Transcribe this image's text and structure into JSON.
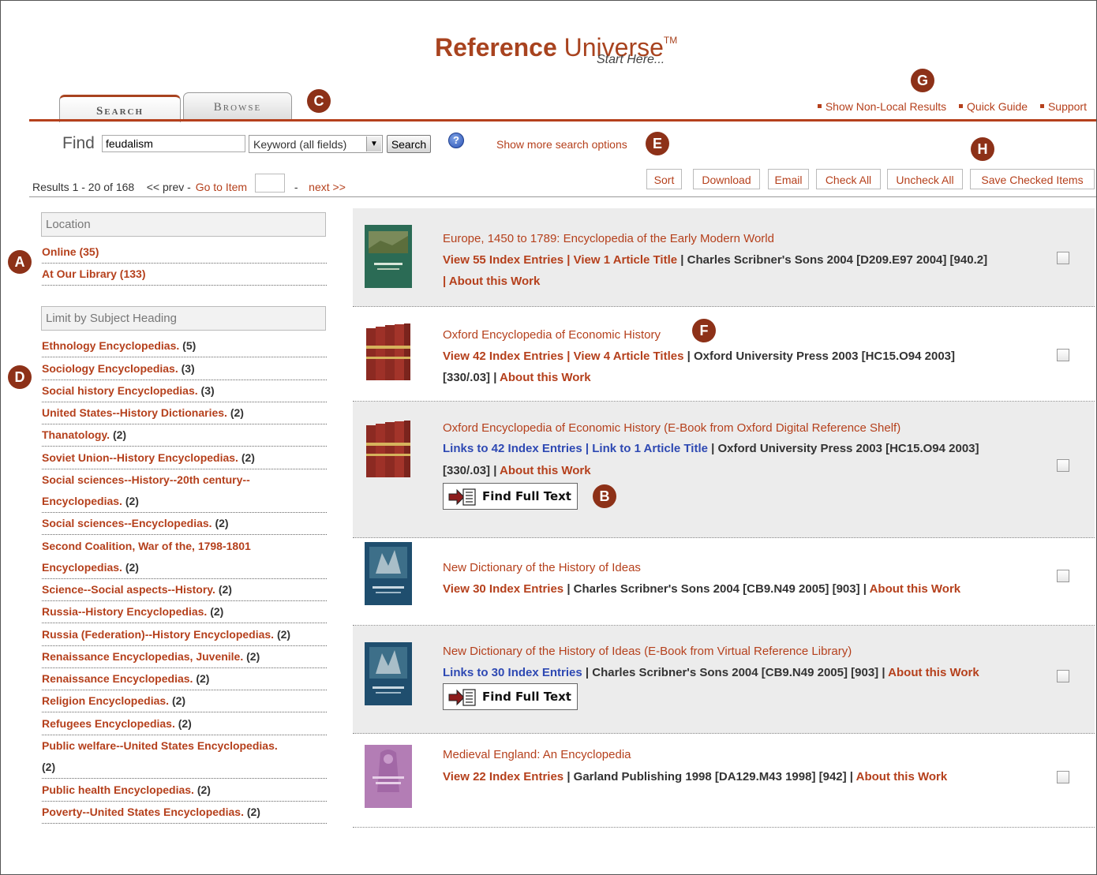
{
  "header": {
    "logo_ref": "Reference",
    "logo_universe": "Universe",
    "logo_tm": "TM",
    "tagline": "Start Here..."
  },
  "tabs": [
    {
      "label": "Search",
      "active": true
    },
    {
      "label": "Browse",
      "active": false
    }
  ],
  "top_links": [
    "Show Non-Local Results",
    "Quick Guide",
    "Support"
  ],
  "search": {
    "find_label": "Find",
    "query": "feudalism",
    "field_select": "Keyword (all fields)",
    "button": "Search",
    "help_icon": "?",
    "more_options": "Show more search options"
  },
  "results_bar": {
    "range": "Results 1 - 20 of 168",
    "prev": "<< prev",
    "dash1": "-",
    "goto": "Go to Item",
    "dash2": "-",
    "next": "next >>",
    "actions": [
      "Sort",
      "Download",
      "Email",
      "Check All",
      "Uncheck All",
      "Save Checked Items"
    ]
  },
  "sidebar": {
    "location_heading": "Location",
    "location_items": [
      {
        "label": "Online",
        "count": "(35)"
      },
      {
        "label": "At Our Library",
        "count": "(133)"
      }
    ],
    "subject_heading": "Limit by Subject Heading",
    "subject_items": [
      {
        "label": "Ethnology Encyclopedias.",
        "count": "(5)"
      },
      {
        "label": "Sociology Encyclopedias.",
        "count": "(3)"
      },
      {
        "label": "Social history Encyclopedias.",
        "count": "(3)"
      },
      {
        "label": "United States--History Dictionaries.",
        "count": "(2)"
      },
      {
        "label": "Thanatology.",
        "count": "(2)"
      },
      {
        "label": "Soviet Union--History Encyclopedias.",
        "count": "(2)"
      },
      {
        "label": "Social sciences--History--20th century--",
        "label2": "Encyclopedias.",
        "count": "(2)"
      },
      {
        "label": "Social sciences--Encyclopedias.",
        "count": "(2)"
      },
      {
        "label": "Second Coalition, War of the, 1798-1801",
        "label2": "Encyclopedias.",
        "count": "(2)"
      },
      {
        "label": "Science--Social aspects--History.",
        "count": "(2)"
      },
      {
        "label": "Russia--History Encyclopedias.",
        "count": "(2)"
      },
      {
        "label": "Russia (Federation)--History Encyclopedias.",
        "count": "(2)"
      },
      {
        "label": "Renaissance Encyclopedias, Juvenile.",
        "count": "(2)"
      },
      {
        "label": "Renaissance Encyclopedias.",
        "count": "(2)"
      },
      {
        "label": "Religion Encyclopedias.",
        "count": "(2)"
      },
      {
        "label": "Refugees Encyclopedias.",
        "count": "(2)"
      },
      {
        "label": "Public welfare--United States Encyclopedias.",
        "label2": "",
        "count": "(2)"
      },
      {
        "label": "Public health Encyclopedias.",
        "count": "(2)"
      },
      {
        "label": "Poverty--United States Encyclopedias.",
        "count": "(2)"
      }
    ]
  },
  "results": [
    {
      "title": "Europe, 1450 to 1789: Encyclopedia of the Early Modern World",
      "links": "View 55 Index Entries | View 1 Article Title",
      "pub": "| Charles Scribner's Sons 2004 [D209.E97 2004] [940.2]",
      "about": "| About this Work"
    },
    {
      "title": "Oxford Encyclopedia of Economic History",
      "links": "View 42 Index Entries | View 4 Article Titles",
      "pub": "| Oxford University Press 2003 [HC15.O94 2003]",
      "pub2": "[330/.03] |",
      "about": "About this Work"
    },
    {
      "title": "Oxford Encyclopedia of Economic History (E-Book from Oxford Digital Reference Shelf)",
      "links": "Links to 42 Index Entries | Link to 1 Article Title",
      "pub": "| Oxford University Press 2003 [HC15.O94 2003]",
      "pub2": "[330/.03] |",
      "about": "About this Work",
      "fft": "Find Full Text"
    },
    {
      "title": "New Dictionary of the History of Ideas",
      "links": "View 30 Index Entries",
      "pub": "| Charles Scribner's Sons 2004 [CB9.N49 2005] [903] |",
      "about": "About this Work"
    },
    {
      "title": "New Dictionary of the History of Ideas (E-Book from Virtual Reference Library)",
      "links": "Links to 30 Index Entries",
      "pub": "| Charles Scribner's Sons 2004 [CB9.N49 2005] [903] |",
      "about": "About this Work",
      "fft": "Find Full Text"
    },
    {
      "title": "Medieval England: An Encyclopedia",
      "links": "View 22 Index Entries",
      "pub": "| Garland Publishing 1998 [DA129.M43 1998] [942] |",
      "about": "About this Work"
    }
  ],
  "markers": [
    "A",
    "B",
    "C",
    "D",
    "E",
    "F",
    "G",
    "H"
  ],
  "colors": {
    "accent": "#b5401c",
    "marker": "#8d3118",
    "link_blue": "#2e49b3",
    "shaded_row": "#ececec"
  }
}
